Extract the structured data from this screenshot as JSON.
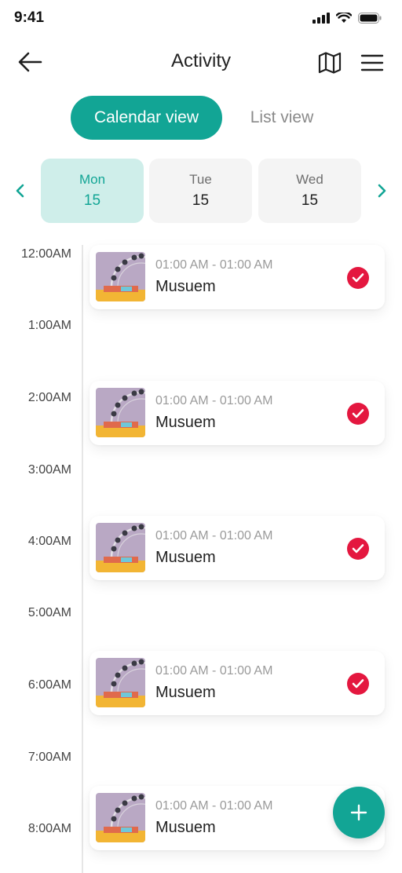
{
  "status_bar": {
    "time": "9:41"
  },
  "header": {
    "title": "Activity"
  },
  "view_toggle": {
    "active": "Calendar view",
    "inactive": "List view"
  },
  "days": [
    {
      "name": "Mon",
      "num": "15",
      "selected": true
    },
    {
      "name": "Tue",
      "num": "15",
      "selected": false
    },
    {
      "name": "Wed",
      "num": "15",
      "selected": false
    }
  ],
  "hours": [
    "12:00AM",
    "1:00AM",
    "2:00AM",
    "3:00AM",
    "4:00AM",
    "5:00AM",
    "6:00AM",
    "7:00AM",
    "8:00AM"
  ],
  "events": [
    {
      "time": "01:00 AM - 01:00 AM",
      "title": "Musuem",
      "done": true
    },
    {
      "time": "01:00 AM - 01:00 AM",
      "title": "Musuem",
      "done": true
    },
    {
      "time": "01:00 AM - 01:00 AM",
      "title": "Musuem",
      "done": true
    },
    {
      "time": "01:00 AM - 01:00 AM",
      "title": "Musuem",
      "done": true
    },
    {
      "time": "01:00 AM - 01:00 AM",
      "title": "Musuem",
      "done": false
    }
  ],
  "colors": {
    "accent": "#12a595",
    "accent_light": "#cfeeea",
    "check": "#e4173f"
  }
}
